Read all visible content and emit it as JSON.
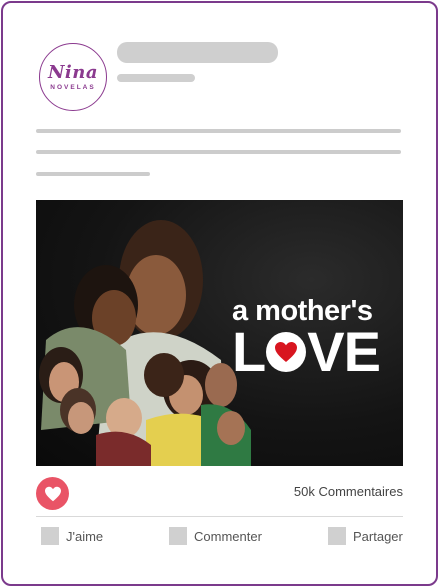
{
  "brand": {
    "logo_main": "Nina",
    "logo_sub": "NOVELAS"
  },
  "poster": {
    "title_line1": "a mother's",
    "title_line2_start": "L",
    "title_line2_end": "VE",
    "heart_color": "#d8151f"
  },
  "stats": {
    "comments": "50k Commentaires"
  },
  "actions": {
    "like": "J'aime",
    "comment": "Commenter",
    "share": "Partager"
  },
  "colors": {
    "border": "#7b3a8c",
    "like_button": "#e95466",
    "placeholder": "#cfcfcf"
  },
  "icons": {
    "like_button_icon": "heart-icon"
  }
}
